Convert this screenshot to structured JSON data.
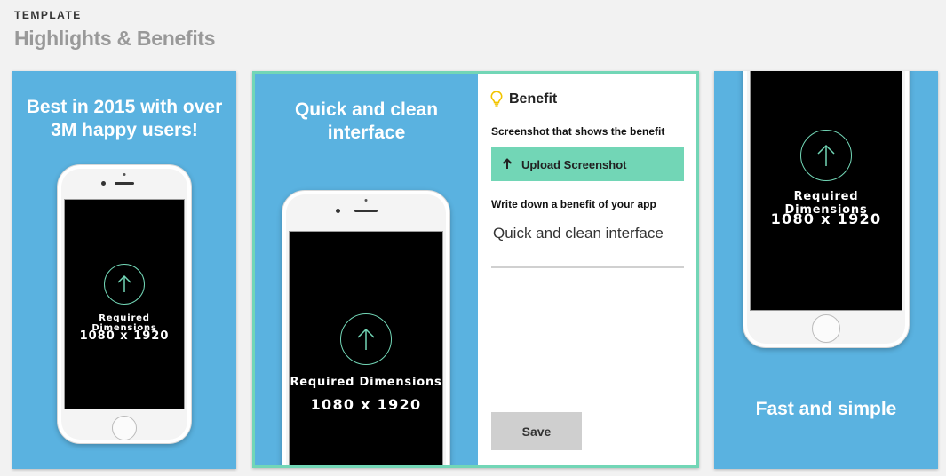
{
  "header": {
    "eyebrow": "TEMPLATE",
    "title": "Highlights & Benefits"
  },
  "cards": [
    {
      "caption_line1": "Best in 2015 with over",
      "caption_line2": "3M happy users!",
      "required_label": "Required Dimensions",
      "dimensions": "1080 x 1920"
    },
    {
      "caption_line1": "Quick and clean",
      "caption_line2": "interface",
      "required_label": "Required Dimensions",
      "dimensions": "1080 x 1920"
    },
    {
      "caption": "Fast and simple",
      "required_label": "Required Dimensions",
      "dimensions": "1080 x 1920"
    }
  ],
  "form": {
    "title": "Benefit",
    "screenshot_label": "Screenshot that shows the benefit",
    "upload_label": "Upload Screenshot",
    "benefit_label": "Write down a benefit of your app",
    "benefit_value": "Quick and clean interface",
    "save_label": "Save"
  },
  "icons": {
    "title_icon": "lightbulb-icon",
    "upload_icon": "arrow-up-icon",
    "screen_icon": "upload-circle-icon"
  },
  "colors": {
    "card_background": "#5ab2e0",
    "accent": "#72d6b6",
    "title_gray": "#999999",
    "save_button": "#cfcfcf"
  }
}
